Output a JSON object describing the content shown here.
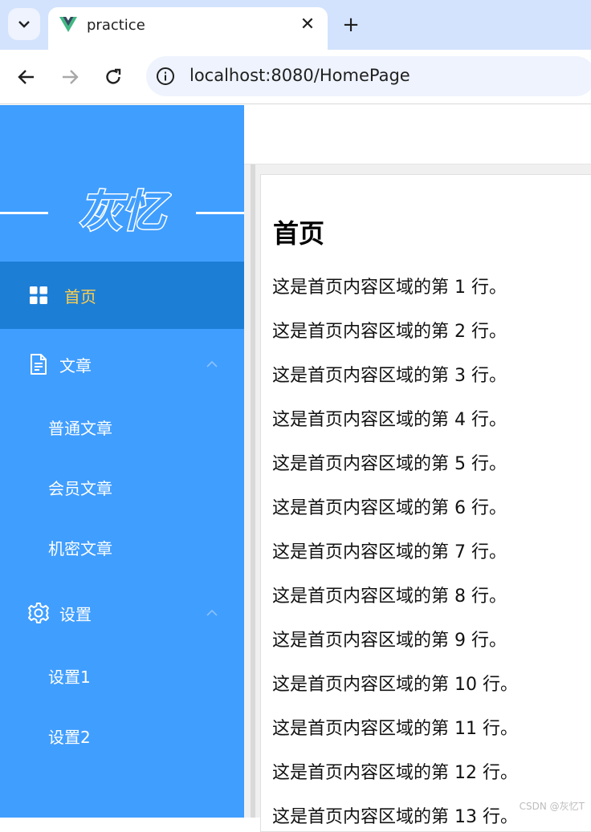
{
  "browser": {
    "tab_title": "practice",
    "url": "localhost:8080/HomePage",
    "new_tab_label": "+",
    "close_label": "✕"
  },
  "sidebar": {
    "logo_text": "灰忆",
    "items": [
      {
        "label": "首页",
        "icon": "grid-icon",
        "active": true
      },
      {
        "label": "文章",
        "icon": "document-icon",
        "expanded": true,
        "children": [
          {
            "label": "普通文章"
          },
          {
            "label": "会员文章"
          },
          {
            "label": "机密文章"
          }
        ]
      },
      {
        "label": "设置",
        "icon": "gear-icon",
        "expanded": true,
        "children": [
          {
            "label": "设置1"
          },
          {
            "label": "设置2"
          }
        ]
      }
    ]
  },
  "content": {
    "heading": "首页",
    "lines": [
      "这是首页内容区域的第 1 行。",
      "这是首页内容区域的第 2 行。",
      "这是首页内容区域的第 3 行。",
      "这是首页内容区域的第 4 行。",
      "这是首页内容区域的第 5 行。",
      "这是首页内容区域的第 6 行。",
      "这是首页内容区域的第 7 行。",
      "这是首页内容区域的第 8 行。",
      "这是首页内容区域的第 9 行。",
      "这是首页内容区域的第 10 行。",
      "这是首页内容区域的第 11 行。",
      "这是首页内容区域的第 12 行。",
      "这是首页内容区域的第 13 行。"
    ]
  },
  "watermark": "CSDN @灰忆T",
  "colors": {
    "sidebar_bg": "#409eff",
    "active_bg": "#1d7ed6",
    "active_text": "#ffd04b",
    "tabstrip_bg": "#d3e3fd"
  }
}
